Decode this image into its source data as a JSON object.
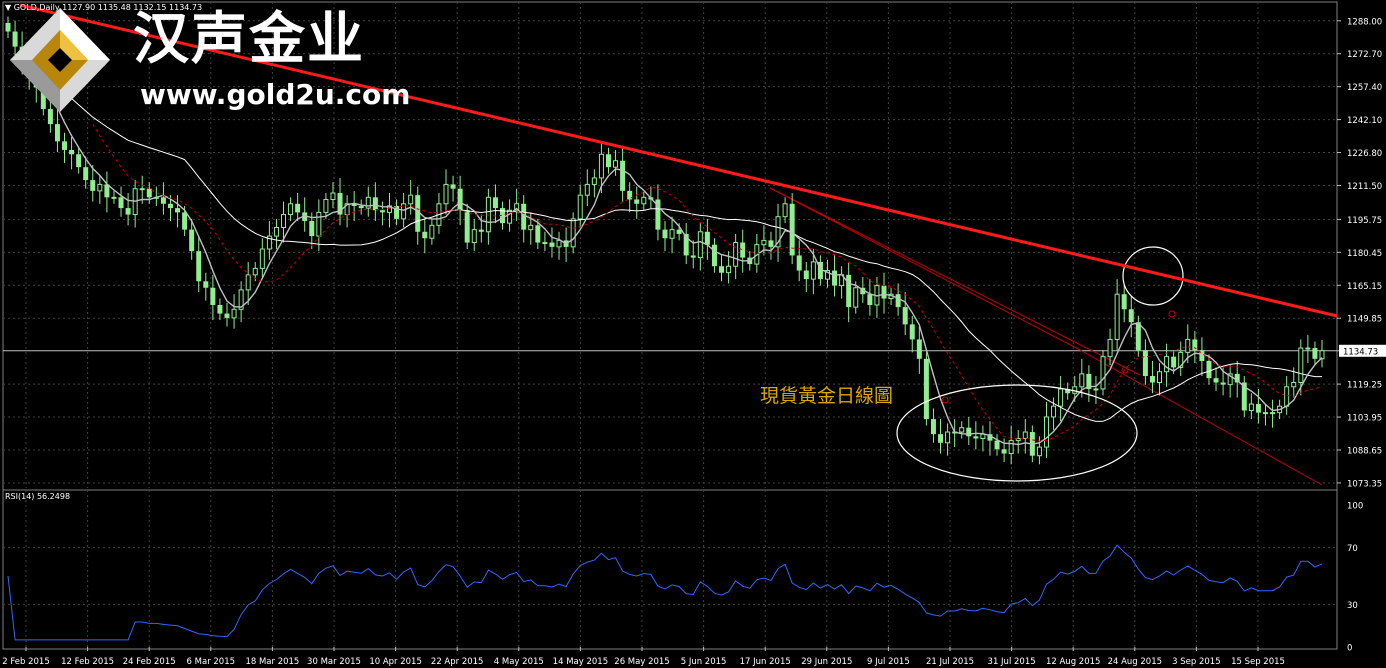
{
  "header": {
    "symbol": "GOLD,Daily",
    "ohlc": "1127.90 1135.48 1132.15 1134.73",
    "rsi": "RSI(14) 56.2498"
  },
  "watermark": {
    "brand": "汉声金业",
    "site": "www.gold2u.com"
  },
  "annotation": "現貨黃金日線圖",
  "colors": {
    "background": "#000000",
    "grid": "#404040",
    "bull_candle": "#90ee90",
    "downtrend_line": "#ff1a1a",
    "channel_line": "#c00000",
    "ma_fast": "#c0c0c0",
    "ma_slow": "#ffffff",
    "ma_dashed": "#cc0000",
    "rsi_line": "#3366ff",
    "annotation_text": "#d9a800"
  },
  "chart_data": [
    {
      "type": "candlestick",
      "symbol": "GOLD",
      "timeframe": "Daily",
      "current_price": "1134.73",
      "y_ticks": [
        "1288.00",
        "1272.70",
        "1257.40",
        "1242.10",
        "1226.80",
        "1211.50",
        "1195.75",
        "1180.45",
        "1165.15",
        "1149.85",
        "1134.73",
        "1119.25",
        "1103.95",
        "1088.65",
        "1073.35"
      ],
      "ylim": [
        1071,
        1293
      ],
      "x_ticks": [
        "2 Feb 2015",
        "12 Feb 2015",
        "24 Feb 2015",
        "6 Mar 2015",
        "18 Mar 2015",
        "30 Mar 2015",
        "10 Apr 2015",
        "22 Apr 2015",
        "4 May 2015",
        "14 May 2015",
        "26 May 2015",
        "5 Jun 2015",
        "17 Jun 2015",
        "29 Jun 2015",
        "9 Jul 2015",
        "21 Jul 2015",
        "31 Jul 2015",
        "12 Aug 2015",
        "24 Aug 2015",
        "3 Sep 2015",
        "15 Sep 2015"
      ],
      "closes": [
        1283,
        1276,
        1268,
        1262,
        1257,
        1247,
        1240,
        1232,
        1228,
        1226,
        1220,
        1214,
        1209,
        1212,
        1206,
        1206,
        1201,
        1198,
        1210,
        1210,
        1206,
        1206,
        1203,
        1201,
        1199,
        1191,
        1181,
        1167,
        1164,
        1156,
        1152,
        1150,
        1154,
        1163,
        1170,
        1173,
        1182,
        1188,
        1192,
        1198,
        1203,
        1199,
        1195,
        1188,
        1199,
        1205,
        1208,
        1198,
        1203,
        1202,
        1201,
        1206,
        1200,
        1199,
        1202,
        1196,
        1203,
        1207,
        1190,
        1187,
        1193,
        1203,
        1212,
        1210,
        1200,
        1185,
        1191,
        1190,
        1206,
        1201,
        1194,
        1200,
        1203,
        1191,
        1193,
        1185,
        1185,
        1183,
        1186,
        1183,
        1196,
        1207,
        1212,
        1215,
        1226,
        1220,
        1223,
        1209,
        1205,
        1203,
        1206,
        1205,
        1191,
        1187,
        1191,
        1189,
        1179,
        1178,
        1190,
        1184,
        1174,
        1171,
        1174,
        1185,
        1178,
        1175,
        1184,
        1186,
        1183,
        1197,
        1203,
        1179,
        1172,
        1168,
        1176,
        1168,
        1172,
        1165,
        1170,
        1155,
        1164,
        1161,
        1156,
        1165,
        1159,
        1161,
        1155,
        1147,
        1140,
        1131,
        1103,
        1096,
        1092,
        1097,
        1097,
        1099,
        1095,
        1094,
        1096,
        1093,
        1089,
        1087,
        1093,
        1094,
        1097,
        1086,
        1090,
        1104,
        1109,
        1117,
        1115,
        1118,
        1124,
        1117,
        1117,
        1132,
        1140,
        1161,
        1154,
        1148,
        1135,
        1123,
        1120,
        1125,
        1132,
        1127,
        1134,
        1140,
        1135,
        1130,
        1122,
        1120,
        1119,
        1124,
        1120,
        1107,
        1110,
        1106,
        1106,
        1106,
        1109,
        1118,
        1120,
        1136,
        1136,
        1131,
        1134.73
      ]
    },
    {
      "type": "line",
      "name": "RSI(14)",
      "y_ticks": [
        "100",
        "70",
        "30",
        "0"
      ],
      "ylim": [
        0,
        100
      ],
      "last_value": 56.2498
    }
  ]
}
